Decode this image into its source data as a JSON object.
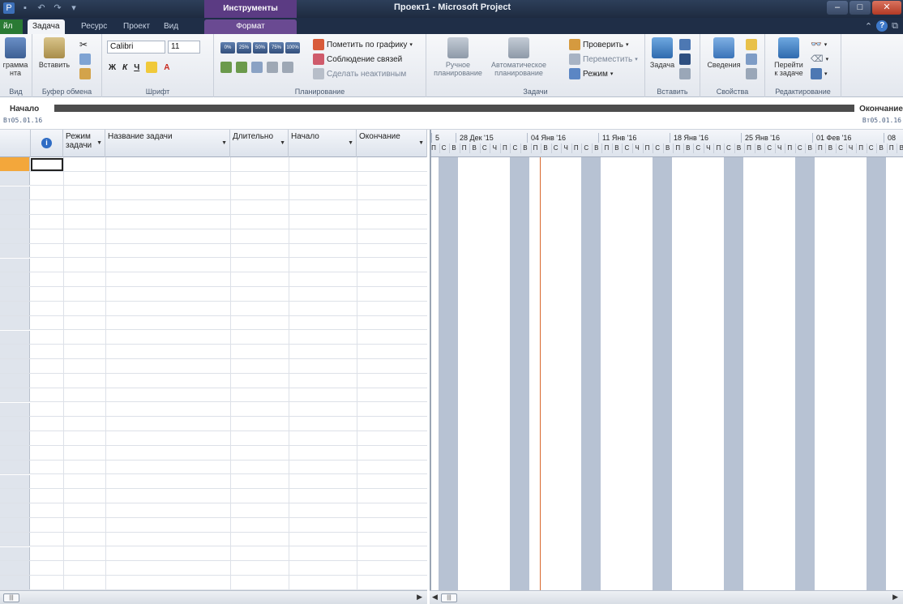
{
  "window": {
    "title": "Проект1 - Microsoft Project",
    "context_header": "Инструменты диаграммы Ганта"
  },
  "tabs": {
    "file": "йл",
    "task": "Задача",
    "resource": "Ресурс",
    "project": "Проект",
    "view": "Вид",
    "format": "Формат"
  },
  "ribbon": {
    "view_group": {
      "label": "Вид",
      "button": "грамма\nнта"
    },
    "clipboard": {
      "label": "Буфер обмена",
      "paste": "Вставить"
    },
    "font": {
      "label": "Шрифт",
      "font_name": "Calibri",
      "font_size": "11",
      "bold": "Ж",
      "italic": "К",
      "underline": "Ч"
    },
    "schedule": {
      "label": "Планирование",
      "pct": [
        "0%",
        "25%",
        "50%",
        "75%",
        "100%"
      ],
      "mark_on_track": "Пометить по графику",
      "respect_links": "Соблюдение связей",
      "inactivate": "Сделать неактивным"
    },
    "tasks": {
      "label": "Задачи",
      "manual": "Ручное\nпланирование",
      "auto": "Автоматическое\nпланирование",
      "inspect": "Проверить",
      "move": "Переместить",
      "mode": "Режим"
    },
    "insert": {
      "label": "Вставить",
      "task": "Задача"
    },
    "properties": {
      "label": "Свойства",
      "info": "Сведения"
    },
    "editing": {
      "label": "Редактирование",
      "scroll_to_task": "Перейти\nк задаче"
    }
  },
  "timeline": {
    "start_label": "Начало",
    "start_date": "Вт05.01.16",
    "end_label": "Окончание",
    "end_date": "Вт05.01.16"
  },
  "table": {
    "columns": [
      {
        "label": "",
        "icon": "info-icon"
      },
      {
        "label": "Режим\nзадачи"
      },
      {
        "label": "Название задачи"
      },
      {
        "label": "Длительно"
      },
      {
        "label": "Начало"
      },
      {
        "label": "Окончание"
      }
    ],
    "row_count": 30
  },
  "gantt": {
    "weeks": [
      "5",
      "28 Дек '15",
      "04 Янв '16",
      "11 Янв '16",
      "18 Янв '16",
      "25 Янв '16",
      "01 Фев '16",
      "08"
    ],
    "days": [
      "П",
      "С",
      "В",
      "П",
      "В",
      "С",
      "Ч",
      "П",
      "С",
      "В",
      "П",
      "В",
      "С",
      "Ч",
      "П",
      "С",
      "В",
      "П",
      "В",
      "С",
      "Ч",
      "П",
      "С",
      "В",
      "П",
      "В",
      "С",
      "Ч",
      "П",
      "С",
      "В",
      "П",
      "В",
      "С",
      "Ч",
      "П",
      "С",
      "В",
      "П",
      "В",
      "С",
      "Ч",
      "П",
      "С",
      "В",
      "П",
      "В",
      "С",
      "Ч",
      "П",
      "С",
      "В",
      "П"
    ],
    "today_color": "#d9682c",
    "weekend_color": "#b7c2d3"
  },
  "colors": {
    "title_bg": "#1e2b40",
    "context_tab": "#5b3b83",
    "file_tab": "#2a7a34",
    "row_select": "#f3a73b"
  }
}
